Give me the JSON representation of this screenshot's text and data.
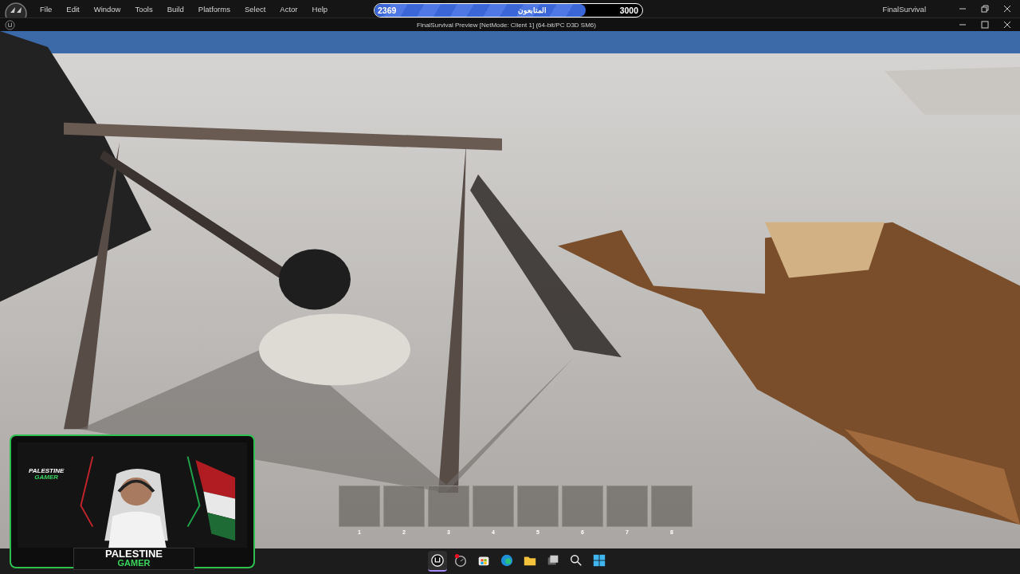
{
  "menu": [
    "File",
    "Edit",
    "Window",
    "Tools",
    "Build",
    "Platforms",
    "Select",
    "Actor",
    "Help"
  ],
  "followers": {
    "label": "المتابعون",
    "current": "2369",
    "goal": "3000",
    "level": 0.79
  },
  "app_title": "FinalSurvival",
  "viewport_title": "FinalSurvival Preview [NetMode: Client 1]  (64-bit/PC D3D SM6)",
  "hotbar": [
    {
      "key": "1"
    },
    {
      "key": "2"
    },
    {
      "key": "3"
    },
    {
      "key": "4"
    },
    {
      "key": "5"
    },
    {
      "key": "6"
    },
    {
      "key": "7"
    },
    {
      "key": "8"
    }
  ],
  "webcam": {
    "logo_top": "PALESTINE",
    "logo_bottom": "GAMER",
    "banner_top": "PALESTINE",
    "banner_bottom": "GAMER"
  },
  "taskbar": [
    {
      "kind": "unreal",
      "selected": true
    },
    {
      "kind": "recorder",
      "selected": false
    },
    {
      "kind": "store",
      "selected": false
    },
    {
      "kind": "edge",
      "selected": false
    },
    {
      "kind": "folder",
      "selected": false
    },
    {
      "kind": "windows",
      "selected": false
    },
    {
      "kind": "search",
      "selected": false
    },
    {
      "kind": "start",
      "selected": false
    }
  ]
}
